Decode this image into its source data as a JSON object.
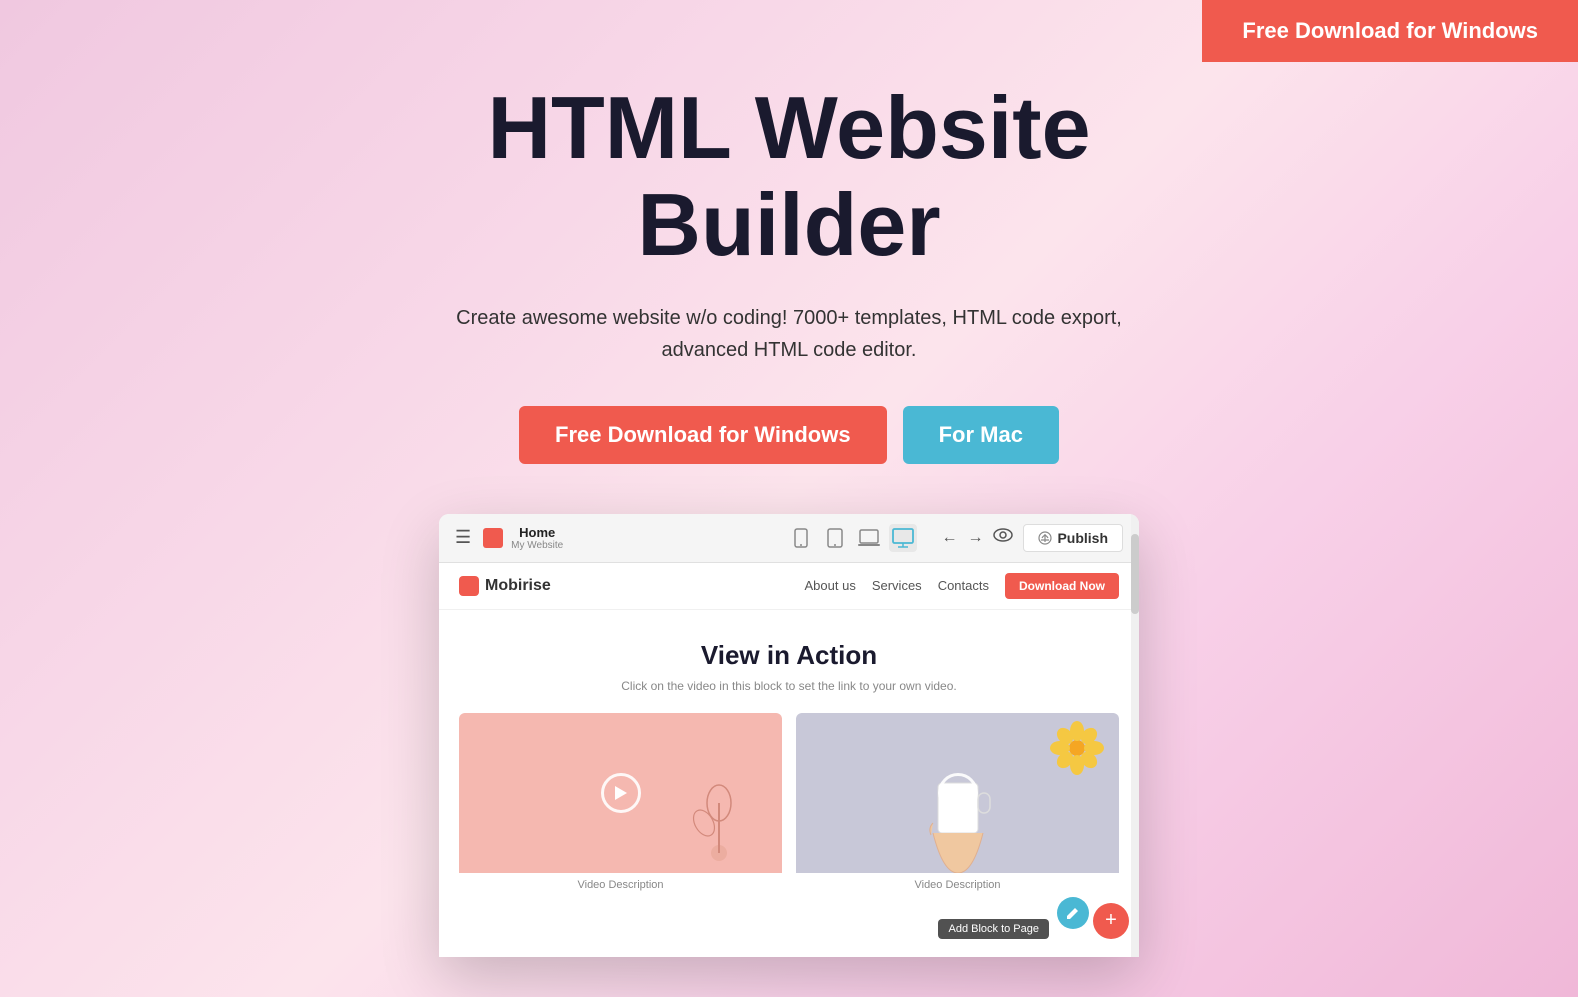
{
  "topCta": {
    "label": "Free Download for Windows"
  },
  "hero": {
    "title": "HTML Website\nBuilder",
    "subtitle": "Create awesome website w/o coding! 7000+ templates, HTML code export, advanced HTML code editor.",
    "btnWindows": "Free Download for Windows",
    "btnMac": "For Mac"
  },
  "browserMockup": {
    "toolbar": {
      "menuIcon": "☰",
      "pageName": "Home",
      "pageSubname": "My Website",
      "deviceIcons": [
        "mobile",
        "tablet",
        "laptop",
        "desktop"
      ],
      "publishLabel": "Publish"
    },
    "siteNav": {
      "logoText": "Mobirise",
      "links": [
        "About us",
        "Services",
        "Contacts"
      ],
      "ctaLabel": "Download Now"
    },
    "content": {
      "title": "View in Action",
      "subtitle": "Click on the video in this block to set the link to your own video.",
      "videos": [
        {
          "desc": "Video Description",
          "bg": "pink"
        },
        {
          "desc": "Video Description",
          "bg": "lavender"
        }
      ]
    },
    "fab": {
      "addBlockLabel": "Add Block to Page",
      "editIcon": "✎",
      "addIcon": "+"
    }
  }
}
